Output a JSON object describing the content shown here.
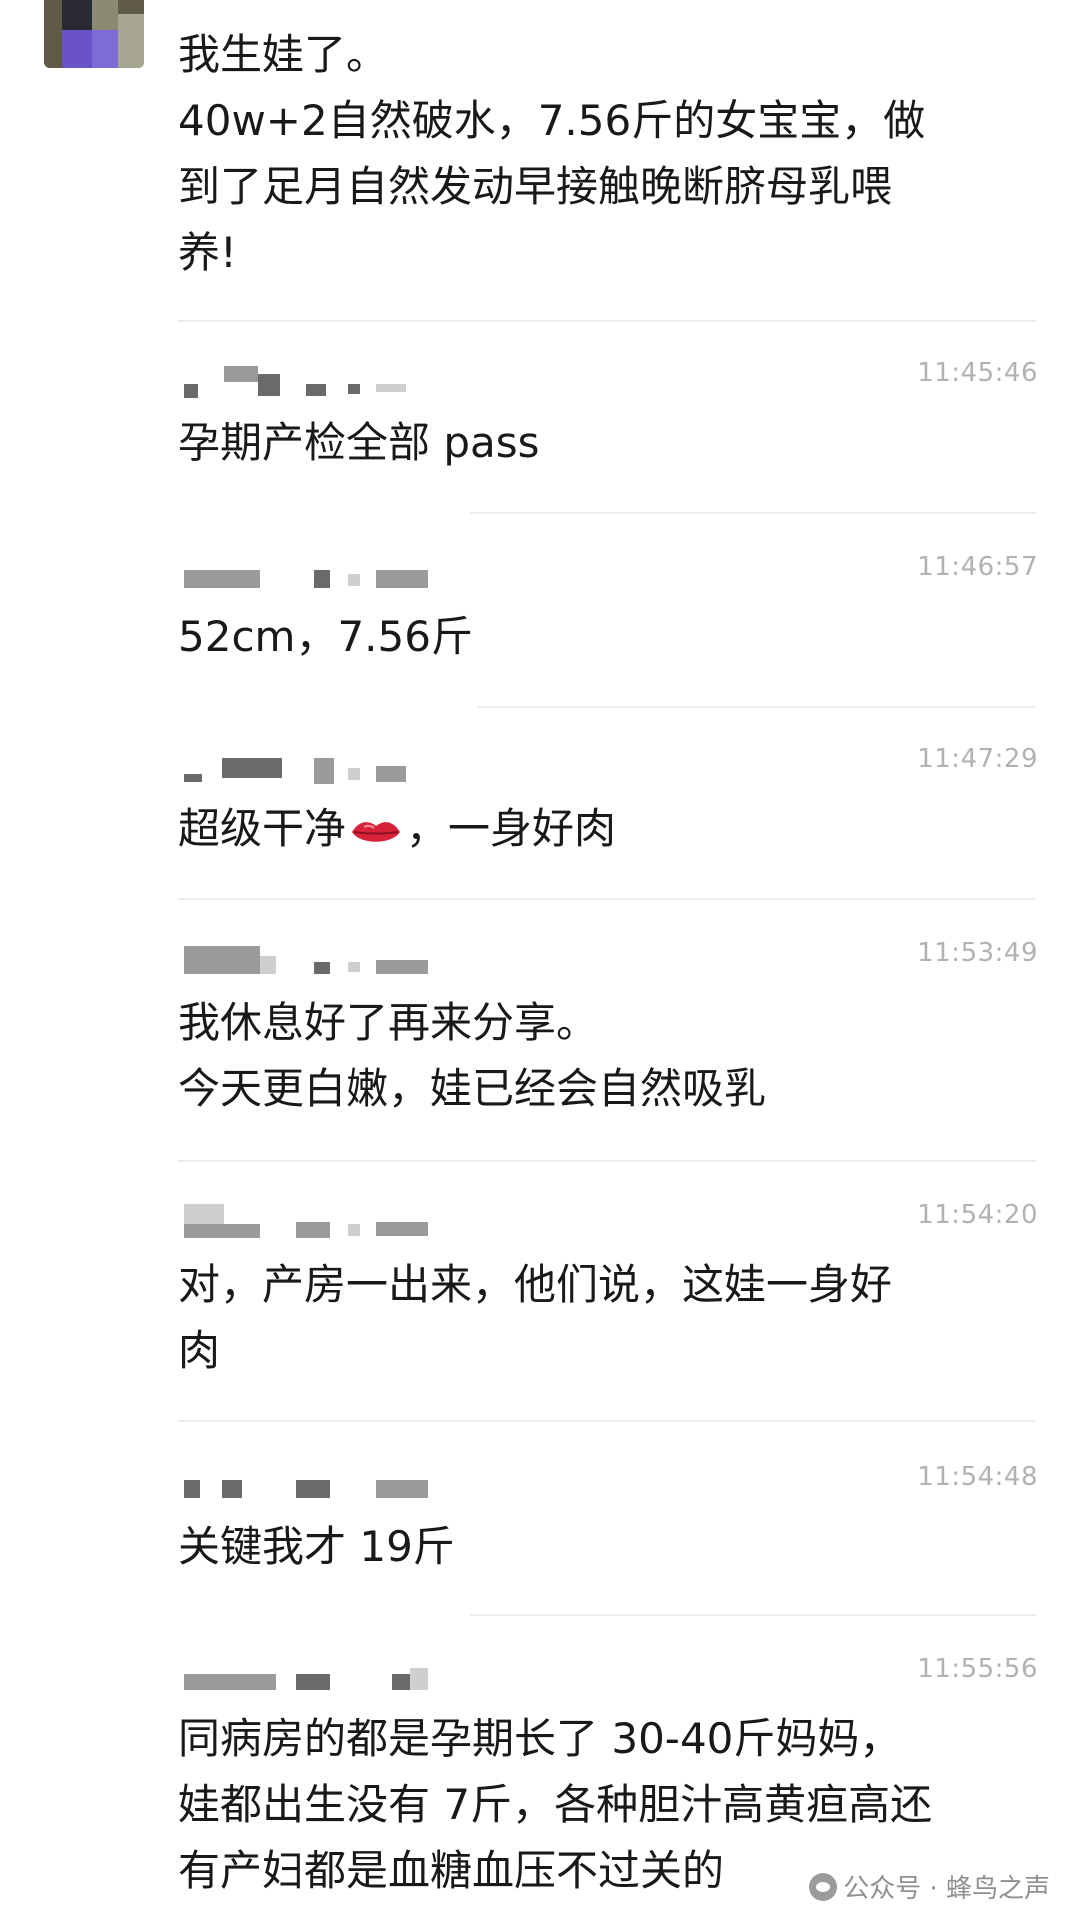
{
  "first_message": {
    "lines": "我生娃了。\n40w+2自然破水，7.56斤的女宝宝，做\n到了足月自然发动早接触晚断脐母乳喂\n养!"
  },
  "messages": [
    {
      "time": "11:45:46",
      "text": "孕期产检全部 pass"
    },
    {
      "time": "11:46:57",
      "text": "52cm，7.56斤"
    },
    {
      "time": "11:47:29",
      "text_before": "超级干净",
      "emoji": "lips-emoji",
      "text_after": "，一身好肉"
    },
    {
      "time": "11:53:49",
      "text": "我休息好了再来分享。\n今天更白嫩，娃已经会自然吸乳"
    },
    {
      "time": "11:54:20",
      "text": "对，产房一出来，他们说，这娃一身好\n肉"
    },
    {
      "time": "11:54:48",
      "text": "关键我才 19斤"
    },
    {
      "time": "11:55:56",
      "text": "同病房的都是孕期长了 30-40斤妈妈，\n娃都出生没有 7斤，各种胆汁高黄疸高还\n有产妇都是血糖血压不过关的"
    }
  ],
  "watermark": {
    "icon": "wechat-official-account-icon",
    "text": "公众号 · 蜂鸟之声"
  }
}
